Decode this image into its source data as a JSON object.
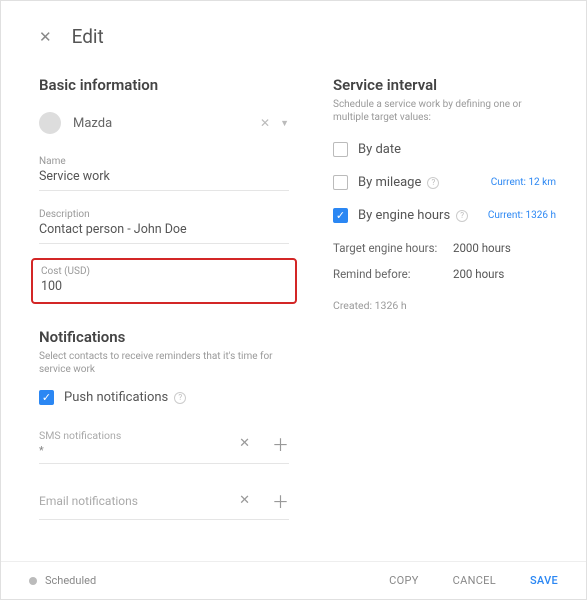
{
  "header": {
    "title": "Edit"
  },
  "basic": {
    "section_title": "Basic information",
    "vehicle": "Mazda",
    "name_label": "Name",
    "name_value": "Service work",
    "description_label": "Description",
    "description_value": "Contact person - John Doe",
    "cost_label": "Cost (USD)",
    "cost_value": "100"
  },
  "notifications": {
    "section_title": "Notifications",
    "section_sub": "Select contacts to receive reminders that it's time for service work",
    "push_label": "Push notifications",
    "sms_label": "SMS notifications",
    "sms_sub": "*",
    "email_label": "Email notifications"
  },
  "interval": {
    "section_title": "Service interval",
    "section_sub": "Schedule a service work by defining one or multiple target values:",
    "by_date_label": "By date",
    "by_mileage_label": "By mileage",
    "by_mileage_current": "Current: 12 km",
    "by_engine_label": "By engine hours",
    "by_engine_current": "Current: 1326 h",
    "target_label": "Target engine hours:",
    "target_value": "2000 hours",
    "remind_label": "Remind before:",
    "remind_value": "200 hours",
    "created_label": "Created: 1326 h"
  },
  "footer": {
    "status": "Scheduled",
    "copy": "COPY",
    "cancel": "CANCEL",
    "save": "SAVE"
  }
}
